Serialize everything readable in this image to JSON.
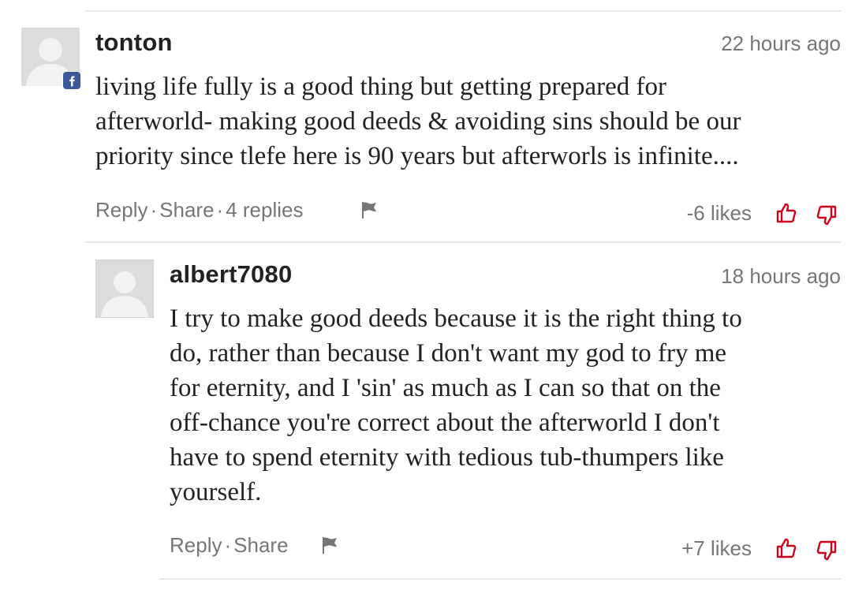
{
  "theme": {
    "accent_red": "#d0021b",
    "facebook_blue": "#3b5998",
    "meta_gray": "#767676"
  },
  "comments": [
    {
      "username": "tonton",
      "timestamp": "22 hours ago",
      "source_icon": "facebook-icon",
      "body_lines": [
        "living life fully is a good thing but getting prepared for",
        "afterworld- making good deeds & avoiding sins should be our",
        "priority since tlefe here is 90 years but afterworls is infinite...."
      ],
      "actions": {
        "reply": "Reply",
        "share": "Share",
        "replies": "4 replies",
        "separator": "·"
      },
      "likes": "-6 likes"
    },
    {
      "username": "albert7080",
      "timestamp": "18 hours ago",
      "body_lines": [
        "I try to make good deeds because it is the right thing to",
        "do, rather than because I don't want my god to fry me",
        "for eternity, and I 'sin' as much as I can so that on the",
        "off-chance you're correct about the afterworld I don't",
        "have to spend eternity with tedious tub-thumpers like",
        "yourself."
      ],
      "actions": {
        "reply": "Reply",
        "share": "Share",
        "separator": "·"
      },
      "likes": "+7 likes"
    }
  ]
}
